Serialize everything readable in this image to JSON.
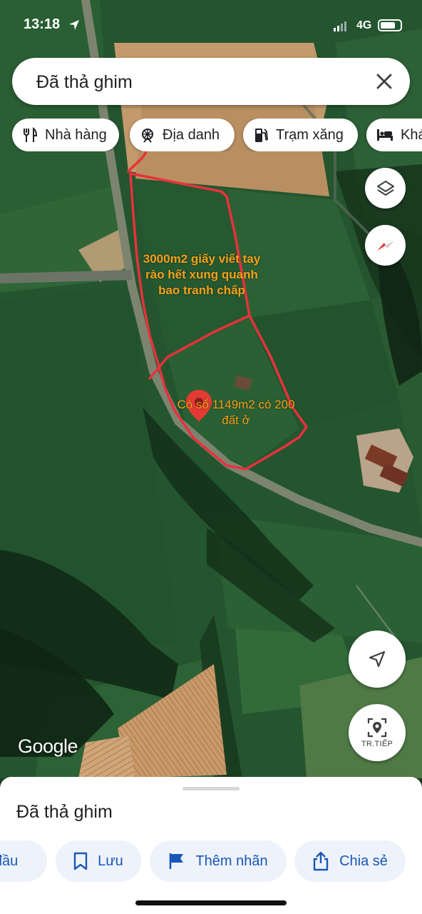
{
  "status_bar": {
    "time": "13:18",
    "network": "4G"
  },
  "search": {
    "query": "Đã thả ghim"
  },
  "chips": [
    {
      "label": "Nhà hàng",
      "icon": "restaurant-icon"
    },
    {
      "label": "Địa danh",
      "icon": "attraction-icon"
    },
    {
      "label": "Trạm xăng",
      "icon": "gas-station-icon"
    },
    {
      "label": "Khá",
      "icon": "hotel-icon"
    }
  ],
  "map": {
    "annotation_1": "3000m2 giấy viết tay rào hết xung quanh bao tranh chấp",
    "annotation_2": "Có sổ 1149m2 có 200 đất ở",
    "annotation_color": "#f5a21b",
    "outline_color": "#e8323c",
    "pin_color": "#e53935",
    "logo": "Google",
    "live_view_label": "TR.TIẾP"
  },
  "bottom_sheet": {
    "title": "Đã thả ghim",
    "actions": [
      {
        "label": "t đầu",
        "icon": "directions-icon"
      },
      {
        "label": "Lưu",
        "icon": "bookmark-icon"
      },
      {
        "label": "Thêm nhãn",
        "icon": "flag-icon"
      },
      {
        "label": "Chia sẻ",
        "icon": "share-icon"
      }
    ]
  },
  "colors": {
    "accent": "#1a56b8",
    "chip_bg": "#eef3fb"
  }
}
